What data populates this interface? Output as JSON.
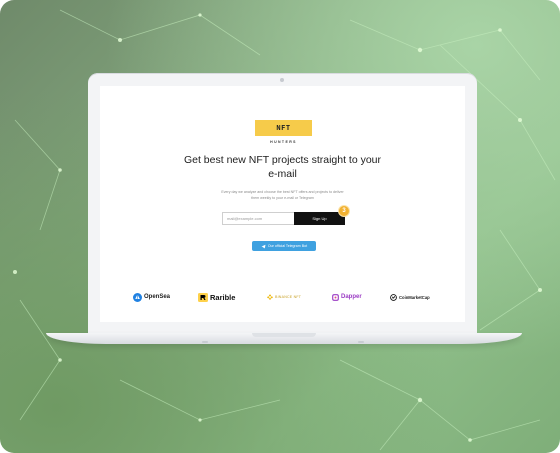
{
  "logo": {
    "text": "NFT",
    "subtitle": "HUNTERS",
    "color": "#f6cb4a"
  },
  "headline": "Get best new NFT projects straight to your e-mail",
  "subtext": "Every day we analyze and choose the best NFT offers and projects to deliver them weekly to your e-mail or Telegram",
  "signup_form": {
    "email_placeholder": "mail@example.com",
    "button_label": "Sign Up",
    "badge_count": "3"
  },
  "telegram_button": {
    "label": "Our official Telegram Bot",
    "icon": "telegram-icon",
    "color": "#3fa1e0"
  },
  "partners": [
    {
      "name": "OpenSea",
      "icon": "opensea-icon"
    },
    {
      "name": "Rarible",
      "icon": "rarible-icon"
    },
    {
      "name": "BINANCE NFT",
      "icon": "binance-icon"
    },
    {
      "name": "Dapper",
      "icon": "dapper-icon"
    },
    {
      "name": "CoinMarketCap",
      "icon": "coinmarketcap-icon"
    }
  ]
}
